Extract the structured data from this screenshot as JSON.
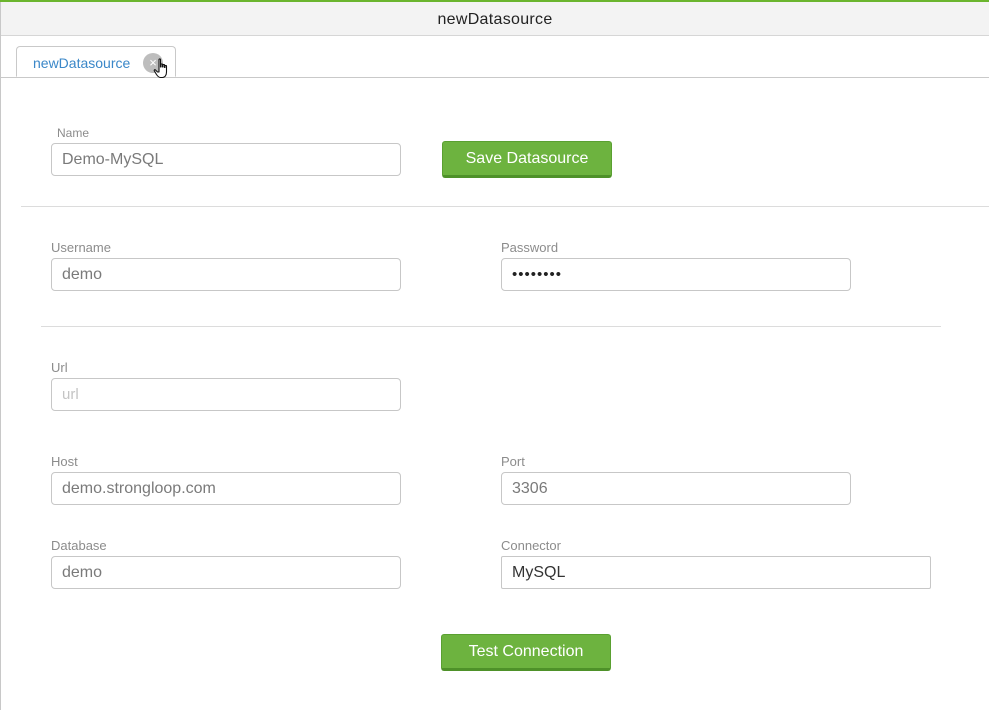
{
  "window": {
    "title": "newDatasource"
  },
  "tabs": [
    {
      "label": "newDatasource",
      "close_symbol": "×"
    }
  ],
  "form": {
    "name": {
      "label": "Name",
      "value": "Demo-MySQL"
    },
    "save_button": "Save Datasource",
    "username": {
      "label": "Username",
      "value": "demo"
    },
    "password": {
      "label": "Password",
      "value": "••••••••"
    },
    "url": {
      "label": "Url",
      "placeholder": "url",
      "value": ""
    },
    "host": {
      "label": "Host",
      "value": "demo.strongloop.com"
    },
    "port": {
      "label": "Port",
      "value": "3306"
    },
    "database": {
      "label": "Database",
      "value": "demo"
    },
    "connector": {
      "label": "Connector",
      "value": "MySQL"
    },
    "test_button": "Test Connection"
  },
  "colors": {
    "accent_green": "#6db33f",
    "tab_text_blue": "#3a87c8",
    "top_line_green": "#6bb52e"
  },
  "icons": {
    "tab_close": "close-icon",
    "cursor": "hand-pointer-icon"
  }
}
